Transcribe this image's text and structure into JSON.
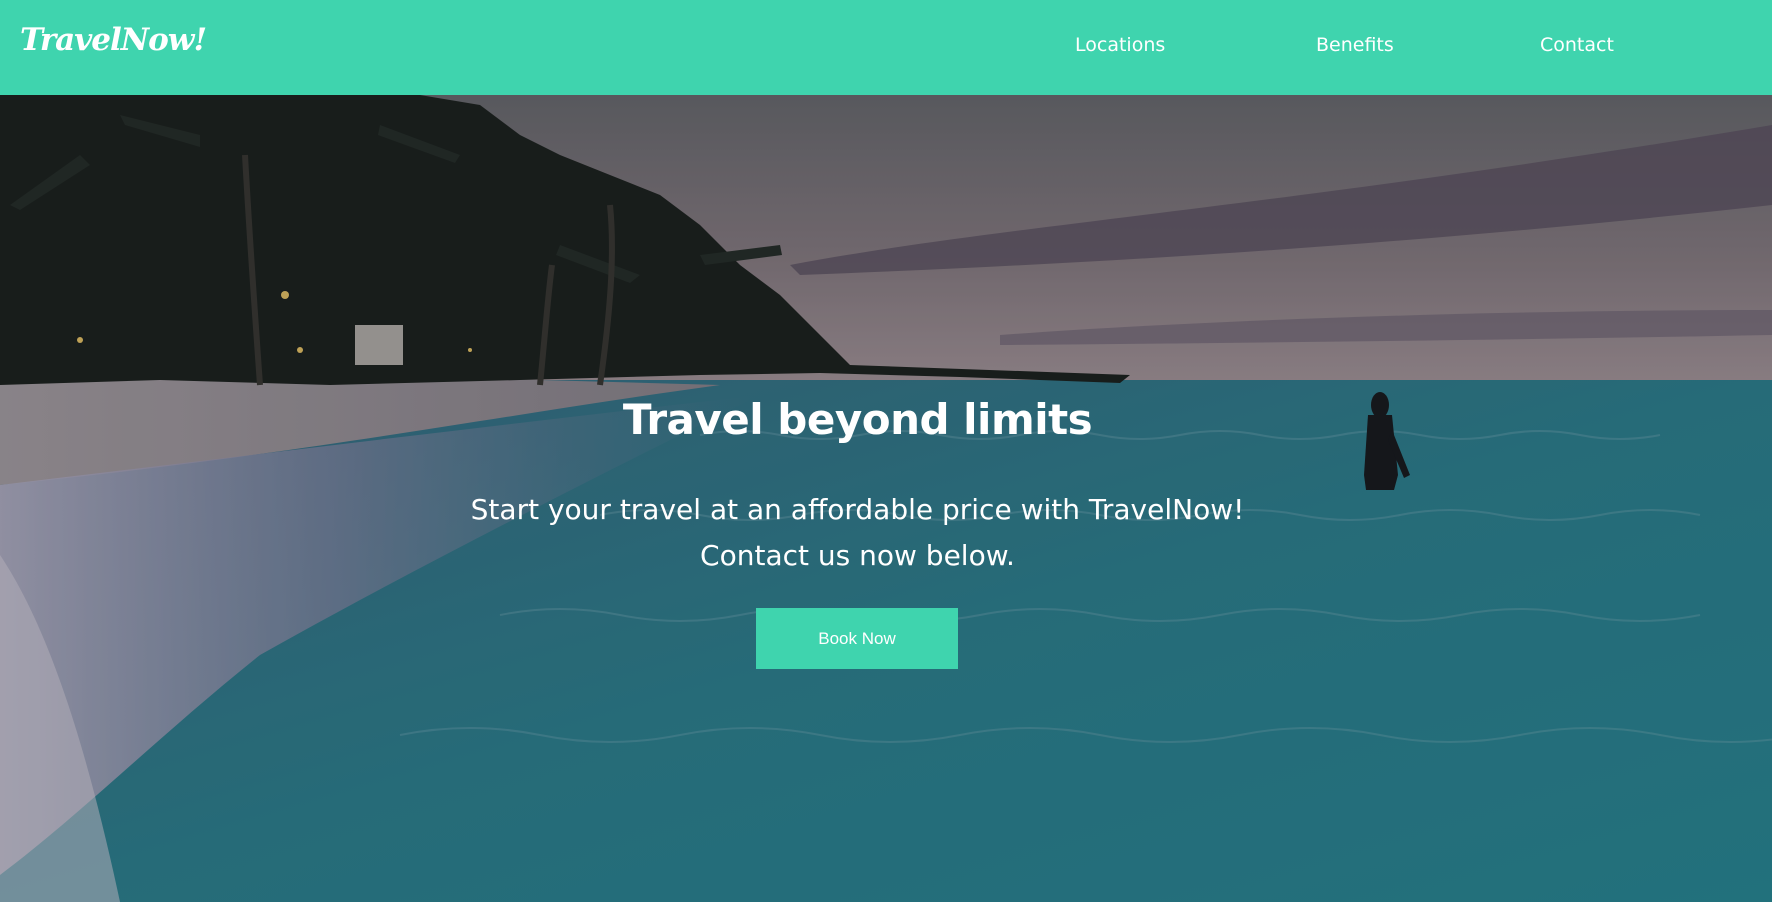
{
  "colors": {
    "brand": "#3fd4ae",
    "text_on_brand": "#ffffff"
  },
  "navbar": {
    "logo": "TravelNow!",
    "links": [
      {
        "label": "Locations"
      },
      {
        "label": "Benefits"
      },
      {
        "label": "Contact"
      }
    ]
  },
  "hero": {
    "background": "tropical-beach-dusk-photo",
    "title": "Travel beyond limits",
    "subtitle_line1": "Start your travel at an affordable price with TravelNow!",
    "subtitle_line2": "Contact us now below.",
    "cta_label": "Book Now"
  }
}
